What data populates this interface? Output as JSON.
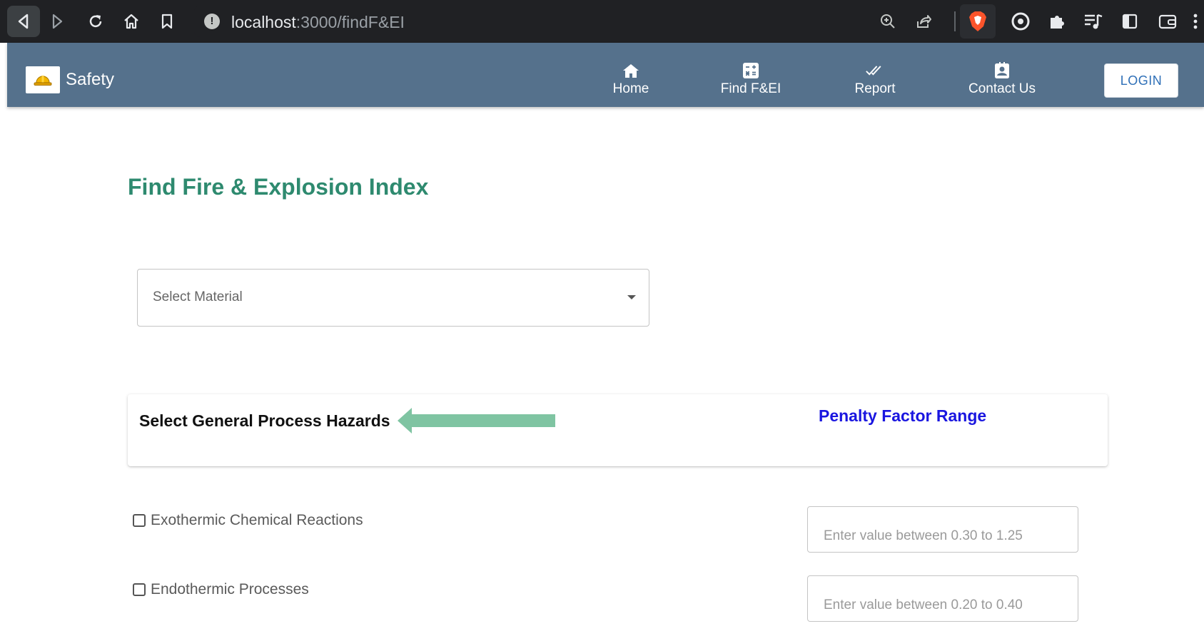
{
  "browser": {
    "url_host": "localhost",
    "url_path": ":3000/findF&EI",
    "icons": [
      "back-icon",
      "forward-icon",
      "reload-icon",
      "home-icon",
      "bookmark-icon",
      "info-icon",
      "zoom-icon",
      "share-icon",
      "brave-shield-icon",
      "vpn-icon",
      "extensions-icon",
      "media-icon",
      "sidebar-icon",
      "wallet-icon",
      "menu-icon"
    ]
  },
  "appbar": {
    "brand": "Safety",
    "nav": [
      {
        "label": "Home",
        "icon": "home-icon"
      },
      {
        "label": "Find F&EI",
        "icon": "calculator-icon"
      },
      {
        "label": "Report",
        "icon": "double-check-icon"
      },
      {
        "label": "Contact Us",
        "icon": "contact-icon"
      }
    ],
    "login_label": "LOGIN"
  },
  "main": {
    "title": "Find Fire & Explosion Index",
    "material_select": {
      "placeholder": "Select Material"
    },
    "hazard_card": {
      "title": "Select General Process Hazards",
      "penalty_title": "Penalty Factor Range"
    },
    "hazards": [
      {
        "label": "Exothermic Chemical Reactions",
        "checked": false,
        "penalty_placeholder": "Enter value between 0.30 to 1.25"
      },
      {
        "label": "Endothermic Processes",
        "checked": false,
        "penalty_placeholder": "Enter value between 0.20 to 0.40"
      }
    ]
  },
  "colors": {
    "appbar": "#55718c",
    "title_green": "#2e8a6f",
    "penalty_blue": "#1a16e0",
    "arrow_green": "#7fc4a2",
    "login_text": "#2e6fb7"
  }
}
